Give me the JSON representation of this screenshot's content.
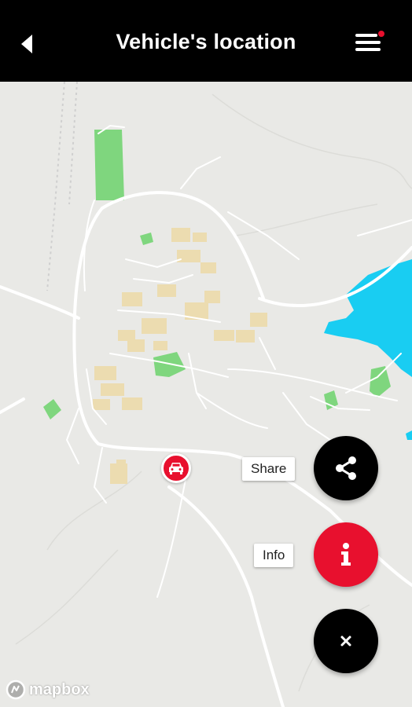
{
  "header": {
    "title": "Vehicle's location"
  },
  "actions": {
    "share_label": "Share",
    "info_label": "Info"
  },
  "attribution": {
    "logo_text": "mapbox"
  },
  "colors": {
    "accent": "#e8102e",
    "menu_dot": "#e8102e",
    "water": "#19cdf2",
    "park": "#7fd67e",
    "building": "#ecdcb0",
    "land": "#e9e9e6"
  },
  "icons": {
    "back": "back-arrow-icon",
    "menu": "menu-icon",
    "vehicle": "car-icon",
    "share": "share-icon",
    "info": "info-icon",
    "close": "close-icon",
    "mapbox": "mapbox-logo-icon"
  }
}
